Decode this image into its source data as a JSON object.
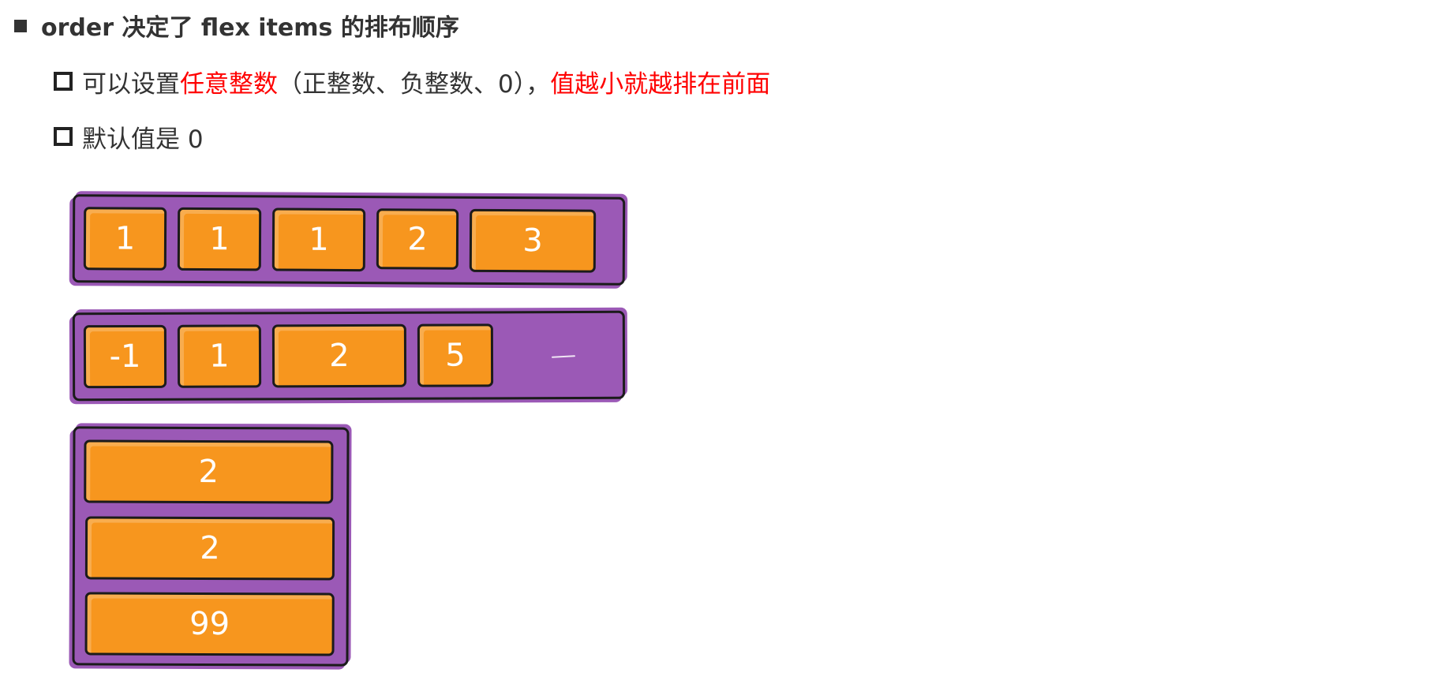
{
  "heading": {
    "text": "order 决定了 flex items 的排布顺序"
  },
  "bullets": [
    {
      "segments": [
        {
          "text": "可以设置",
          "color": "#333333"
        },
        {
          "text": "任意整数",
          "color": "#ff0000"
        },
        {
          "text": "（正整数、负整数、0），",
          "color": "#333333"
        },
        {
          "text": "值越小就越排在前面",
          "color": "#ff0000"
        }
      ]
    },
    {
      "segments": [
        {
          "text": "默认值是 0",
          "color": "#333333"
        }
      ]
    }
  ],
  "diagrams": [
    {
      "direction": "row",
      "items": [
        "1",
        "1",
        "1",
        "2",
        "3"
      ]
    },
    {
      "direction": "row",
      "items": [
        "-1",
        "1",
        "2",
        "5"
      ]
    },
    {
      "direction": "column",
      "items": [
        "2",
        "2",
        "99"
      ]
    }
  ],
  "colors": {
    "container": "#9b59b6",
    "item": "#f7961e",
    "border": "#1b1b1b",
    "highlight": "#ff0000"
  }
}
